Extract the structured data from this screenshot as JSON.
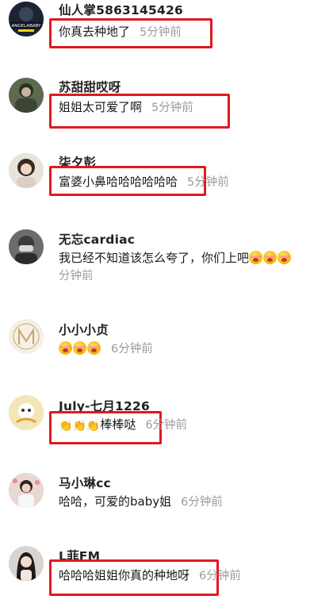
{
  "comments": [
    {
      "name": "仙人掌5863145426",
      "text": "你真去种地了",
      "time": "5分钟前",
      "avatar": "angelababy-avatar",
      "avatar_caption": "ANGELABABY"
    },
    {
      "name": "苏甜甜哎呀",
      "text": "姐姐太可爱了啊",
      "time": "5分钟前",
      "avatar": "person-avatar"
    },
    {
      "name": "柒夕彭",
      "text": "富婆小鼻哈哈哈哈哈哈",
      "time": "5分钟前",
      "avatar": "girl-avatar"
    },
    {
      "name": "无忘cardiac",
      "text": "我已经不知道该怎么夸了，你们上吧",
      "time": "分钟前",
      "emoji_count": 3,
      "avatar": "mask-avatar"
    },
    {
      "name": "小小小贞",
      "text": "",
      "time": "6分钟前",
      "emoji_count": 3,
      "avatar": "logo-avatar"
    },
    {
      "name": "July-七月1226",
      "text": "棒棒哒",
      "time": "6分钟前",
      "clap_count": 3,
      "avatar": "cartoon-avatar"
    },
    {
      "name": "马小琳cc",
      "text": "哈哈，可爱的baby姐",
      "time": "6分钟前",
      "avatar": "photo-avatar"
    },
    {
      "name": "L菲FM",
      "text": "哈哈哈姐姐你真的种地呀",
      "time": "6分钟前",
      "avatar": "woman-avatar"
    }
  ],
  "colors": {
    "highlight": "#e0191f",
    "time": "#9b9b9b",
    "name": "#222222"
  }
}
